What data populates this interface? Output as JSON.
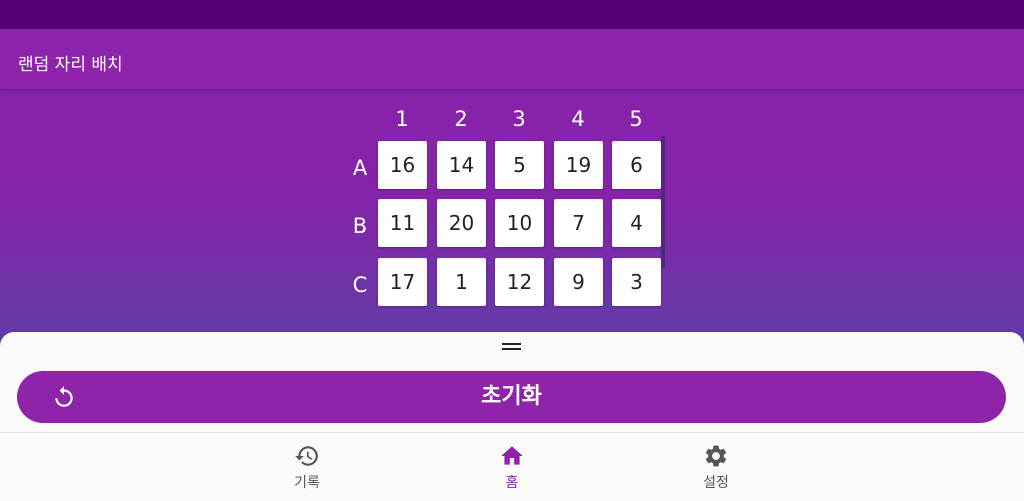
{
  "app": {
    "title": "랜덤 자리 배치"
  },
  "grid": {
    "columns": [
      "1",
      "2",
      "3",
      "4",
      "5"
    ],
    "rows": [
      {
        "label": "A",
        "seats": [
          "16",
          "14",
          "5",
          "19",
          "6"
        ]
      },
      {
        "label": "B",
        "seats": [
          "11",
          "20",
          "10",
          "7",
          "4"
        ]
      },
      {
        "label": "C",
        "seats": [
          "17",
          "1",
          "12",
          "9",
          "3"
        ]
      }
    ]
  },
  "sheet": {
    "reset_label": "초기화",
    "reset_icon": "restart-icon"
  },
  "nav": {
    "items": [
      {
        "label": "기록",
        "icon": "history-icon",
        "active": false
      },
      {
        "label": "홈",
        "icon": "home-icon",
        "active": true
      },
      {
        "label": "설정",
        "icon": "settings-icon",
        "active": false
      }
    ]
  },
  "colors": {
    "primary": "#8e24aa",
    "status_bar": "#560075",
    "inactive": "#555555"
  }
}
